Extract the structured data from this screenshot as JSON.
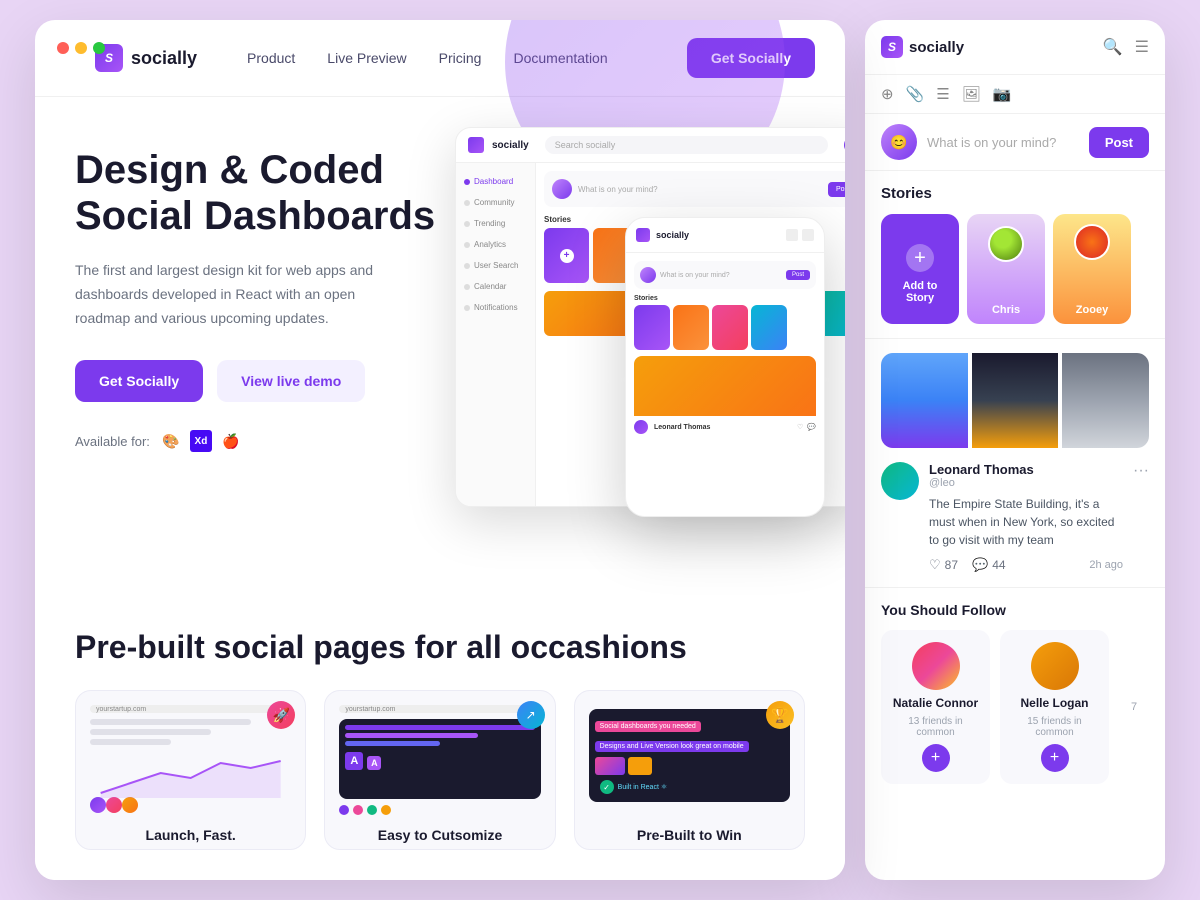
{
  "app": {
    "name": "socially",
    "logo_text": "socially"
  },
  "nav": {
    "product": "Product",
    "live_preview": "Live Preview",
    "pricing": "Pricing",
    "documentation": "Documentation",
    "cta": "Get Socially"
  },
  "hero": {
    "title": "Design & Coded Social Dashboards",
    "description": "The first and largest design kit for web apps and dashboards developed in React with an open roadmap and various upcoming updates.",
    "btn_primary": "Get Socially",
    "btn_secondary": "View live demo",
    "available_label": "Available for:"
  },
  "second_section": {
    "title": "Pre-built social pages for all occashions",
    "cards": [
      {
        "label": "Launch, Fast."
      },
      {
        "label": "Easy to Cutsomize"
      },
      {
        "label": "Pre-Built to Win"
      }
    ]
  },
  "right_panel": {
    "logo": "socially",
    "post_placeholder": "What is on your mind?",
    "post_btn": "Post",
    "stories_label": "Stories",
    "stories": [
      {
        "label": "Add to Story",
        "type": "add"
      },
      {
        "label": "Chris",
        "type": "person"
      },
      {
        "label": "Zooey",
        "type": "person"
      }
    ],
    "post": {
      "user": "Leonard Thomas",
      "handle": "@leo",
      "text": "The Empire State Building, it's a must when in New York, so excited to go visit with my team",
      "likes": "87",
      "comments": "44",
      "time": "2h ago"
    },
    "follow_section": {
      "title": "You Should Follow",
      "users": [
        {
          "name": "Natalie Connor",
          "mutual": "13 friends in common"
        },
        {
          "name": "Nelle Logan",
          "mutual": "15 friends in common"
        }
      ],
      "count": "7"
    }
  },
  "dashboard": {
    "search_placeholder": "Search socially",
    "sidebar_items": [
      "Dashboard",
      "Community",
      "Trending",
      "Analytics",
      "User Search",
      "Calendar",
      "Notifications"
    ],
    "post_placeholder": "What is on your mind?",
    "post_btn": "Post",
    "stories_label": "Stories"
  },
  "window": {
    "dots": [
      "red",
      "yellow",
      "green"
    ]
  }
}
